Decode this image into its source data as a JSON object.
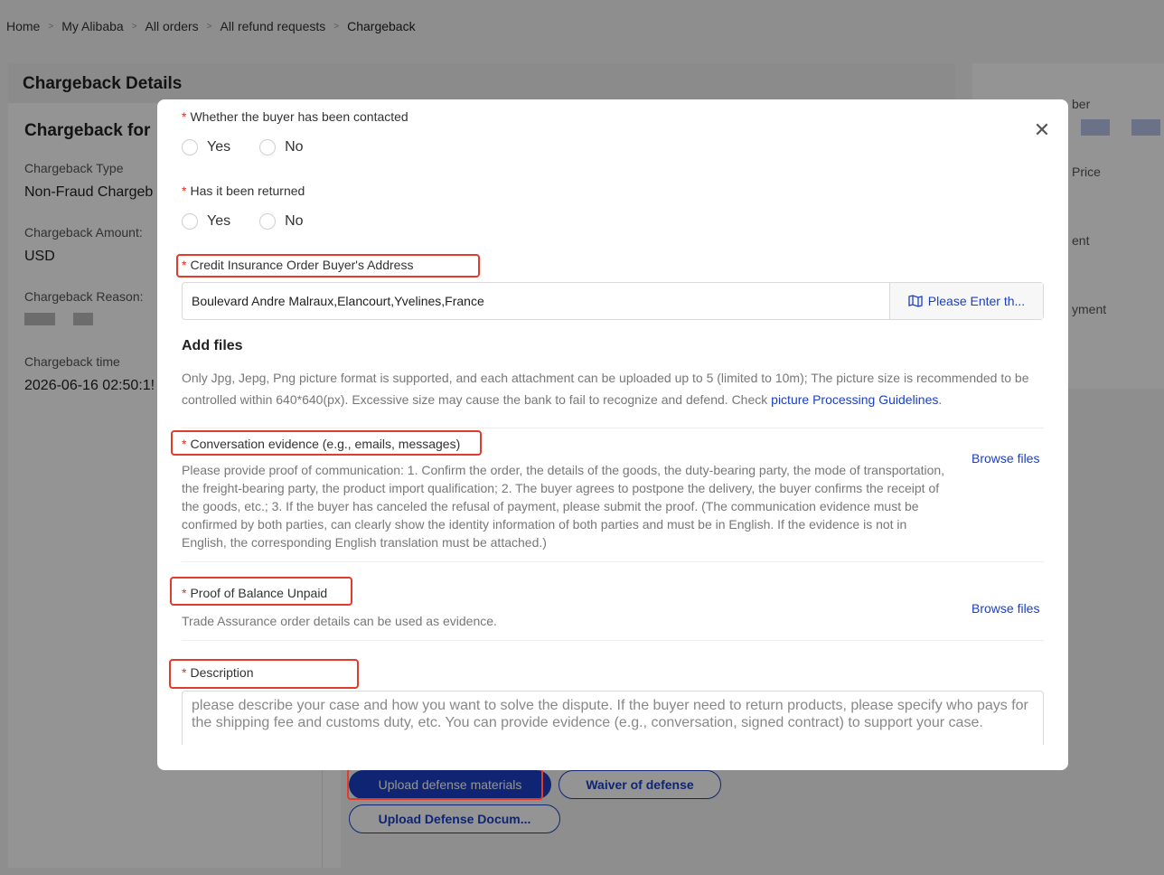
{
  "breadcrumb": [
    "Home",
    "My Alibaba",
    "All orders",
    "All refund requests",
    "Chargeback"
  ],
  "background": {
    "panel_title": "Chargeback Details",
    "section_title": "Chargeback for",
    "chargeback_type_label": "Chargeback Type",
    "chargeback_type_value": "Non-Fraud Chargeb",
    "amount_label": "Chargeback Amount:",
    "amount_value": "USD",
    "reason_label": "Chargeback Reason:",
    "time_label": "Chargeback time",
    "time_value": "2026-06-16 02:50:1!",
    "side_labels": [
      "ber",
      "Price",
      "ent",
      "yment"
    ],
    "upload_button": "Upload defense materials",
    "waiver_button": "Waiver of defense",
    "upload_docs_button": "Upload Defense Docum..."
  },
  "modal": {
    "close_icon": "close-icon",
    "q_contacted": "Whether the buyer has been contacted",
    "q_returned": "Has it been returned",
    "yes": "Yes",
    "no": "No",
    "address_label": "Credit Insurance Order Buyer's Address",
    "address_value": "Boulevard Andre Malraux,Elancourt,Yvelines,France",
    "address_map_button": "Please Enter th...",
    "add_files_title": "Add files",
    "add_files_note": "Only Jpg, Jepg, Png picture format is supported, and each attachment can be uploaded up to 5 (limited to 10m); The picture size is recommended to be controlled within 640*640(px). Excessive size may cause the bank to fail to recognize and defend. Check ",
    "add_files_link": "picture Processing Guidelines",
    "add_files_end": ".",
    "conv_label": "Conversation evidence (e.g., emails, messages)",
    "conv_desc": "Please provide proof of communication: 1. Confirm the order, the details of the goods, the duty-bearing party, the mode of transportation, the freight-bearing party, the product import qualification; 2. The buyer agrees to postpone the delivery, the buyer confirms the receipt of the goods, etc.; 3. If the buyer has canceled the refusal of payment, please submit the proof. (The communication evidence must be confirmed by both parties, can clearly show the identity information of both parties and must be in English. If the evidence is not in English, the corresponding English translation must be attached.)",
    "browse_files": "Browse files",
    "balance_label": "Proof of Balance Unpaid",
    "balance_desc": "Trade Assurance order details can be used as evidence.",
    "description_label": "Description",
    "description_placeholder": "please describe your case and how you want to solve the dispute. If the buyer need to return products, please specify who pays for the shipping fee and customs duty, etc. You can provide evidence (e.g., conversation, signed contract) to support your case."
  },
  "colors": {
    "accent": "#1a3fc4",
    "highlight": "#e33a2a",
    "required": "#e0301e"
  }
}
